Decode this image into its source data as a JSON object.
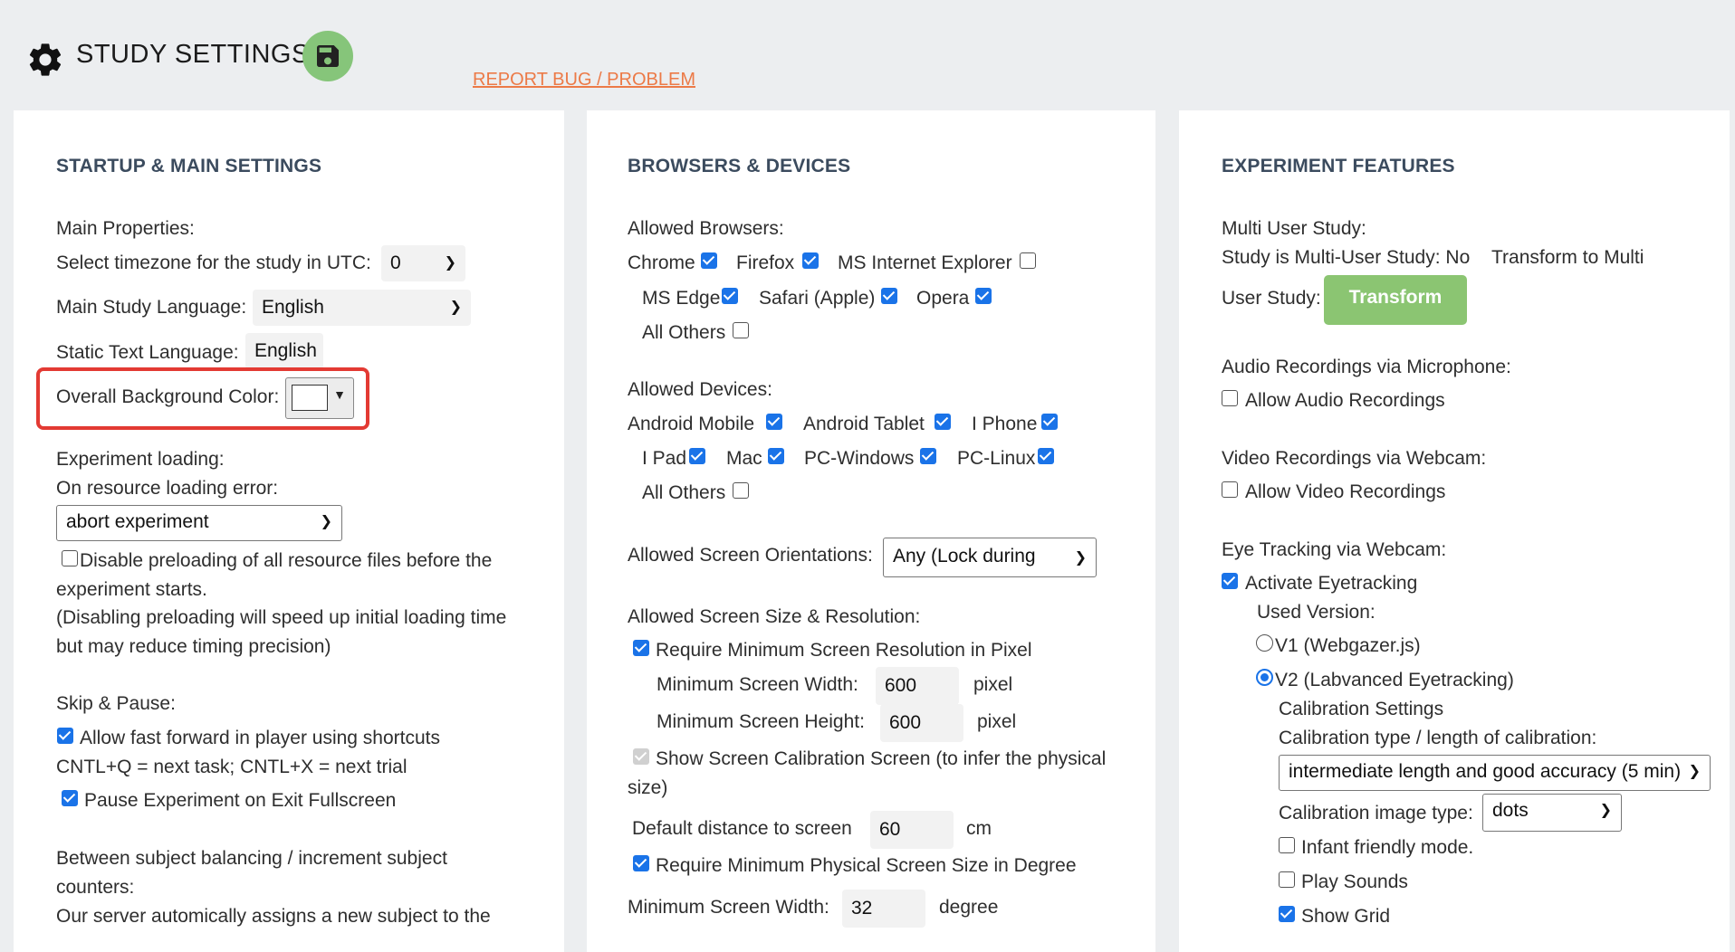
{
  "header": {
    "title": "STUDY SETTINGS",
    "report_link": "REPORT BUG / PROBLEM"
  },
  "icons": {
    "gear": "gear-icon",
    "save": "save-icon"
  },
  "colors": {
    "accent_link": "#ec7a47",
    "save_button": "#86c57a",
    "transform_button": "#8bc572",
    "checkbox": "#1a73e8",
    "highlight": "#e33a33"
  },
  "startup": {
    "section_title": "STARTUP & MAIN SETTINGS",
    "main_properties": "Main Properties:",
    "timezone_label": "Select timezone for the study in UTC:",
    "timezone_value": "0",
    "language_label": "Main Study Language:",
    "language_value": "English",
    "static_text_label": "Static Text Language:",
    "static_text_value": "English",
    "bg_color_label": "Overall Background Color:",
    "experiment_loading": "Experiment loading:",
    "resource_error_label": "On resource loading error:",
    "resource_error_value": "abort experiment",
    "disable_preload_line1": "Disable preloading of all resource files before the",
    "disable_preload_line2": "experiment starts.",
    "preload_note_line1": "(Disabling preloading will speed up initial loading time",
    "preload_note_line2": "but may reduce timing precision)",
    "skip_pause": "Skip & Pause:",
    "fast_forward": "Allow fast forward in player using shortcuts",
    "shortcuts": "CNTL+Q = next task; CNTL+X = next trial",
    "pause_fullscreen": "Pause Experiment on Exit Fullscreen",
    "balancing_line1": "Between subject balancing / increment subject",
    "balancing_line2": "counters:",
    "balancing_line3": "Our server automically assigns a new subject to the"
  },
  "browsers": {
    "section_title": "BROWSERS & DEVICES",
    "allowed_browsers": "Allowed Browsers:",
    "chrome": "Chrome",
    "firefox": "Firefox",
    "ie": "MS Internet Explorer",
    "edge": "MS Edge",
    "safari": "Safari (Apple)",
    "opera": "Opera",
    "all_others_browsers": "All Others",
    "allowed_devices": "Allowed Devices:",
    "android_mobile": "Android Mobile",
    "android_tablet": "Android Tablet",
    "iphone": "I Phone",
    "ipad": "I Pad",
    "mac": "Mac",
    "pc_windows": "PC-Windows",
    "pc_linux": "PC-Linux",
    "all_others_devices": "All Others",
    "orientations_label": "Allowed Screen Orientations:",
    "orientations_value": "Any (Lock during Run)",
    "size_resolution": "Allowed Screen Size & Resolution:",
    "require_min_res": "Require Minimum Screen Resolution in Pixel",
    "min_width_label": "Minimum Screen Width:",
    "min_width_value": "600",
    "min_height_label": "Minimum Screen Height:",
    "min_height_value": "600",
    "pixel_unit": "pixel",
    "calibration_line1": "Show Screen Calibration Screen (to infer the physical",
    "calibration_line2": "size)",
    "distance_label": "Default distance to screen",
    "distance_value": "60",
    "distance_unit": "cm",
    "require_physical": "Require Minimum Physical Screen Size in Degree",
    "min_width_deg_label": "Minimum Screen Width:",
    "min_width_deg_value": "32",
    "degree_unit": "degree"
  },
  "features": {
    "section_title": "EXPERIMENT FEATURES",
    "multi_user": "Multi User Study:",
    "multi_user_status": "Study is Multi-User Study: No",
    "transform_to_multi": "Transform to Multi",
    "user_study": "User Study:",
    "transform_button": "Transform",
    "audio_title": "Audio Recordings via Microphone:",
    "audio_cb": "Allow Audio Recordings",
    "video_title": "Video Recordings via Webcam:",
    "video_cb": "Allow Video Recordings",
    "eye_title": "Eye Tracking via Webcam:",
    "activate_eye": "Activate Eyetracking",
    "used_version": "Used Version:",
    "v1": "V1 (Webgazer.js)",
    "v2": "V2 (Labvanced Eyetracking)",
    "calib_settings": "Calibration Settings",
    "calib_type_label": "Calibration type / length of calibration:",
    "calib_type_value": "intermediate length and good accuracy (5 min)",
    "calib_image_label": "Calibration image type:",
    "calib_image_value": "dots",
    "infant": "Infant friendly mode.",
    "play_sounds": "Play Sounds",
    "show_grid": "Show Grid"
  }
}
